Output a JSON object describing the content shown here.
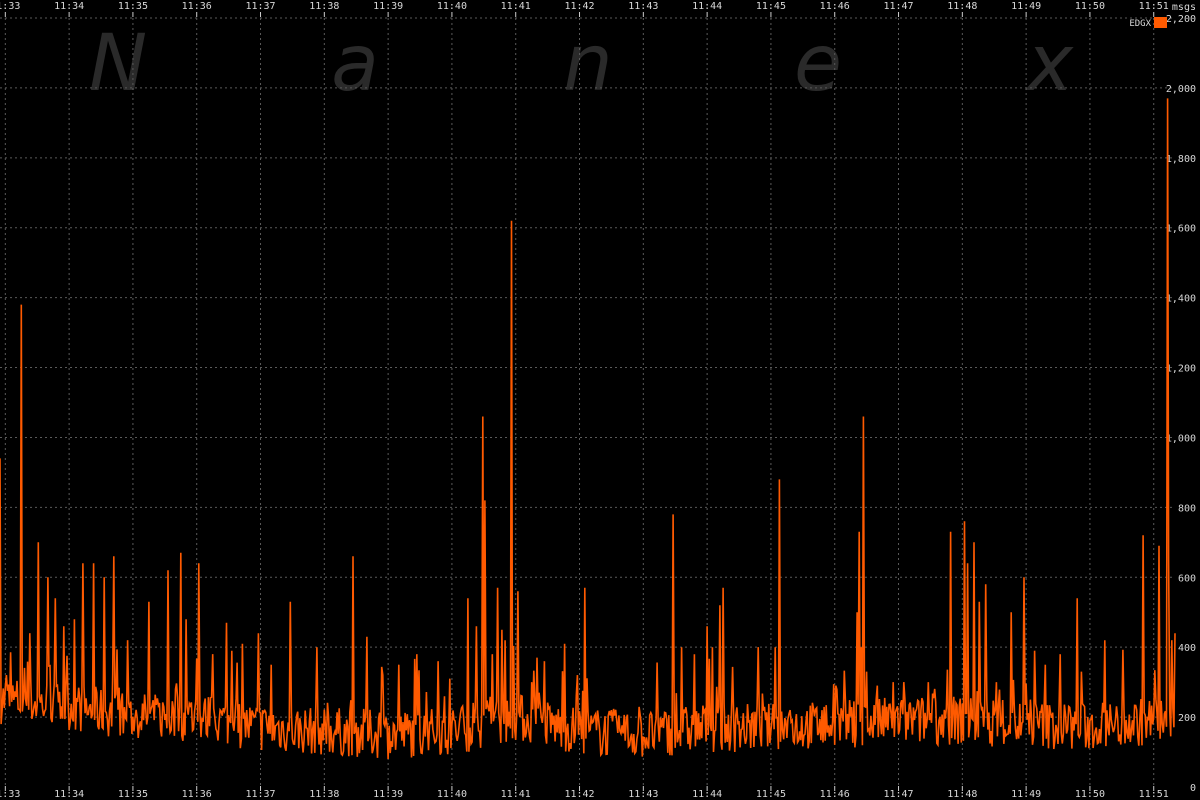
{
  "watermark": [
    "N",
    "a",
    "n",
    "e",
    "x"
  ],
  "chart_data": {
    "type": "line",
    "title": "",
    "xlabel": "",
    "ylabel": "msgs",
    "ylim": [
      0,
      2200
    ],
    "y_ticks": [
      0,
      200,
      400,
      600,
      800,
      1000,
      1200,
      1400,
      1600,
      1800,
      2000,
      2200
    ],
    "y_tick_labels": [
      "0",
      "200",
      "400",
      "600",
      "800",
      "1,000",
      "1,200",
      "1,400",
      "1,600",
      "1,800",
      "2,000",
      "2,200"
    ],
    "x_ticks": [
      "11:33",
      "11:34",
      "11:35",
      "11:36",
      "11:37",
      "11:38",
      "11:39",
      "11:40",
      "11:41",
      "11:42",
      "11:43",
      "11:44",
      "11:45",
      "11:46",
      "11:47",
      "11:48",
      "11:49",
      "11:50",
      "11:51"
    ],
    "x_range_minutes": [
      "11:32:55",
      "11:51:20"
    ],
    "grid": true,
    "legend_position": "top-right",
    "series": [
      {
        "name": "EDGX",
        "color": "#ff5a00",
        "spikes": [
          {
            "t": "11:32:55",
            "v": 940
          },
          {
            "t": "11:33:01",
            "v": 320
          },
          {
            "t": "11:33:15",
            "v": 1380
          },
          {
            "t": "11:33:23",
            "v": 440
          },
          {
            "t": "11:33:31",
            "v": 700
          },
          {
            "t": "11:33:40",
            "v": 600
          },
          {
            "t": "11:33:47",
            "v": 540
          },
          {
            "t": "11:33:55",
            "v": 460
          },
          {
            "t": "11:34:05",
            "v": 480
          },
          {
            "t": "11:34:13",
            "v": 640
          },
          {
            "t": "11:34:23",
            "v": 640
          },
          {
            "t": "11:34:33",
            "v": 600
          },
          {
            "t": "11:34:42",
            "v": 660
          },
          {
            "t": "11:34:55",
            "v": 420
          },
          {
            "t": "11:35:15",
            "v": 530
          },
          {
            "t": "11:35:33",
            "v": 620
          },
          {
            "t": "11:35:45",
            "v": 670
          },
          {
            "t": "11:35:50",
            "v": 480
          },
          {
            "t": "11:36:02",
            "v": 640
          },
          {
            "t": "11:36:15",
            "v": 380
          },
          {
            "t": "11:36:28",
            "v": 470
          },
          {
            "t": "11:36:33",
            "v": 390
          },
          {
            "t": "11:36:43",
            "v": 410
          },
          {
            "t": "11:36:58",
            "v": 440
          },
          {
            "t": "11:37:10",
            "v": 350
          },
          {
            "t": "11:37:28",
            "v": 530
          },
          {
            "t": "11:37:53",
            "v": 400
          },
          {
            "t": "11:38:27",
            "v": 660
          },
          {
            "t": "11:38:40",
            "v": 430
          },
          {
            "t": "11:38:55",
            "v": 320
          },
          {
            "t": "11:39:10",
            "v": 350
          },
          {
            "t": "11:39:27",
            "v": 380
          },
          {
            "t": "11:39:47",
            "v": 360
          },
          {
            "t": "11:39:58",
            "v": 310
          },
          {
            "t": "11:40:15",
            "v": 540
          },
          {
            "t": "11:40:23",
            "v": 460
          },
          {
            "t": "11:40:29",
            "v": 1060
          },
          {
            "t": "11:40:31",
            "v": 820
          },
          {
            "t": "11:40:38",
            "v": 380
          },
          {
            "t": "11:40:43",
            "v": 570
          },
          {
            "t": "11:40:47",
            "v": 450
          },
          {
            "t": "11:40:50",
            "v": 420
          },
          {
            "t": "11:40:56",
            "v": 1620
          },
          {
            "t": "11:41:02",
            "v": 560
          },
          {
            "t": "11:41:15",
            "v": 300
          },
          {
            "t": "11:41:20",
            "v": 370
          },
          {
            "t": "11:41:27",
            "v": 360
          },
          {
            "t": "11:41:46",
            "v": 410
          },
          {
            "t": "11:41:58",
            "v": 320
          },
          {
            "t": "11:42:05",
            "v": 570
          },
          {
            "t": "11:42:30",
            "v": 220
          },
          {
            "t": "11:43:28",
            "v": 780
          },
          {
            "t": "11:43:36",
            "v": 400
          },
          {
            "t": "11:43:48",
            "v": 380
          },
          {
            "t": "11:44:00",
            "v": 460
          },
          {
            "t": "11:44:05",
            "v": 400
          },
          {
            "t": "11:44:12",
            "v": 520
          },
          {
            "t": "11:44:15",
            "v": 570
          },
          {
            "t": "11:44:48",
            "v": 400
          },
          {
            "t": "11:45:04",
            "v": 400
          },
          {
            "t": "11:45:08",
            "v": 880
          },
          {
            "t": "11:45:18",
            "v": 220
          },
          {
            "t": "11:45:48",
            "v": 220
          },
          {
            "t": "11:46:01",
            "v": 290
          },
          {
            "t": "11:46:21",
            "v": 500
          },
          {
            "t": "11:46:23",
            "v": 730
          },
          {
            "t": "11:46:25",
            "v": 400
          },
          {
            "t": "11:46:27",
            "v": 1060
          },
          {
            "t": "11:46:30",
            "v": 330
          },
          {
            "t": "11:46:40",
            "v": 290
          },
          {
            "t": "11:46:55",
            "v": 300
          },
          {
            "t": "11:47:05",
            "v": 300
          },
          {
            "t": "11:47:28",
            "v": 300
          },
          {
            "t": "11:47:49",
            "v": 730
          },
          {
            "t": "11:48:02",
            "v": 760
          },
          {
            "t": "11:48:05",
            "v": 640
          },
          {
            "t": "11:48:11",
            "v": 700
          },
          {
            "t": "11:48:16",
            "v": 530
          },
          {
            "t": "11:48:22",
            "v": 580
          },
          {
            "t": "11:48:32",
            "v": 300
          },
          {
            "t": "11:48:46",
            "v": 500
          },
          {
            "t": "11:48:58",
            "v": 600
          },
          {
            "t": "11:49:08",
            "v": 390
          },
          {
            "t": "11:49:18",
            "v": 350
          },
          {
            "t": "11:49:32",
            "v": 380
          },
          {
            "t": "11:49:48",
            "v": 540
          },
          {
            "t": "11:49:52",
            "v": 330
          },
          {
            "t": "11:50:14",
            "v": 420
          },
          {
            "t": "11:50:32",
            "v": 220
          },
          {
            "t": "11:50:50",
            "v": 720
          },
          {
            "t": "11:51:05",
            "v": 690
          },
          {
            "t": "11:51:13",
            "v": 1970
          },
          {
            "t": "11:51:14",
            "v": 650
          },
          {
            "t": "11:51:17",
            "v": 420
          },
          {
            "t": "11:51:20",
            "v": 440
          }
        ],
        "baseline": [
          {
            "t": "11:33",
            "v": 250
          },
          {
            "t": "11:34",
            "v": 230
          },
          {
            "t": "11:35",
            "v": 200
          },
          {
            "t": "11:36",
            "v": 200
          },
          {
            "t": "11:37",
            "v": 170
          },
          {
            "t": "11:38",
            "v": 160
          },
          {
            "t": "11:39",
            "v": 150
          },
          {
            "t": "11:40",
            "v": 160
          },
          {
            "t": "11:41",
            "v": 200
          },
          {
            "t": "11:42",
            "v": 160
          },
          {
            "t": "11:43",
            "v": 150
          },
          {
            "t": "11:44",
            "v": 170
          },
          {
            "t": "11:45",
            "v": 170
          },
          {
            "t": "11:46",
            "v": 180
          },
          {
            "t": "11:47",
            "v": 190
          },
          {
            "t": "11:48",
            "v": 190
          },
          {
            "t": "11:49",
            "v": 180
          },
          {
            "t": "11:50",
            "v": 170
          },
          {
            "t": "11:51",
            "v": 190
          }
        ]
      }
    ]
  }
}
